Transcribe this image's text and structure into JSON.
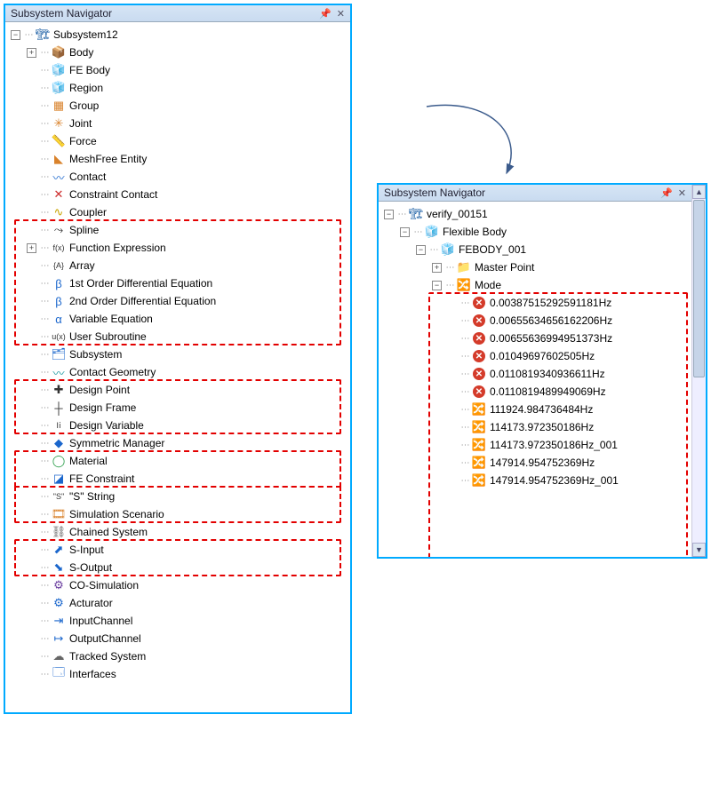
{
  "leftPanel": {
    "title": "Subsystem Navigator",
    "root": {
      "label": "Subsystem12"
    },
    "items": [
      {
        "label": "Body",
        "icon": "📦",
        "cls": "c-blue",
        "t": "+"
      },
      {
        "label": "FE Body",
        "icon": "🧊",
        "cls": "c-gold",
        "t": ""
      },
      {
        "label": "Region",
        "icon": "🧊",
        "cls": "c-gold",
        "t": ""
      },
      {
        "label": "Group",
        "icon": "▦",
        "cls": "c-orange",
        "t": ""
      },
      {
        "label": "Joint",
        "icon": "✳",
        "cls": "c-orange",
        "t": ""
      },
      {
        "label": "Force",
        "icon": "📏",
        "cls": "c-blue",
        "t": ""
      },
      {
        "label": "MeshFree Entity",
        "icon": "◣",
        "cls": "c-orange",
        "t": ""
      },
      {
        "label": "Contact",
        "icon": "〰",
        "cls": "c-blue",
        "t": ""
      },
      {
        "label": "Constraint Contact",
        "icon": "✕",
        "cls": "c-red",
        "t": ""
      },
      {
        "label": "Coupler",
        "icon": "∿",
        "cls": "c-gold",
        "t": ""
      },
      {
        "label": "Spline",
        "icon": "⤳",
        "cls": "c-dark",
        "t": ""
      },
      {
        "label": "Function Expression",
        "icon": "f(x)",
        "cls": "c-dark",
        "t": "+",
        "small": true
      },
      {
        "label": "Array",
        "icon": "{A}",
        "cls": "c-dark",
        "t": "",
        "small": true
      },
      {
        "label": "1st Order Differential Equation",
        "icon": "β",
        "cls": "c-blue",
        "t": ""
      },
      {
        "label": "2nd Order Differential Equation",
        "icon": "β",
        "cls": "c-blue",
        "t": ""
      },
      {
        "label": "Variable Equation",
        "icon": "α",
        "cls": "c-blue",
        "t": ""
      },
      {
        "label": "User Subroutine",
        "icon": "u(x)",
        "cls": "c-dark",
        "t": "",
        "small": true
      },
      {
        "label": "Subsystem",
        "icon": "🗂",
        "cls": "c-blue",
        "t": ""
      },
      {
        "label": "Contact Geometry",
        "icon": "〰",
        "cls": "c-teal",
        "t": ""
      },
      {
        "label": "Design Point",
        "icon": "✚",
        "cls": "c-dark",
        "t": ""
      },
      {
        "label": "Design Frame",
        "icon": "┼",
        "cls": "c-dark",
        "t": ""
      },
      {
        "label": "Design Variable",
        "icon": "Ⅰⅰ",
        "cls": "c-dark",
        "t": "",
        "small": true
      },
      {
        "label": "Symmetric Manager",
        "icon": "◆",
        "cls": "c-blue",
        "t": ""
      },
      {
        "label": "Material",
        "icon": "◯",
        "cls": "c-green",
        "t": ""
      },
      {
        "label": "FE Constraint",
        "icon": "◪",
        "cls": "c-blue",
        "t": ""
      },
      {
        "label": "\"S\" String",
        "icon": "\"S\"",
        "cls": "c-dark",
        "t": "",
        "small": true
      },
      {
        "label": "Simulation Scenario",
        "icon": "🎞",
        "cls": "c-orange",
        "t": ""
      },
      {
        "label": "Chained System",
        "icon": "⛓",
        "cls": "c-gray",
        "t": ""
      },
      {
        "label": "S-Input",
        "icon": "⬈",
        "cls": "c-blue",
        "t": ""
      },
      {
        "label": "S-Output",
        "icon": "⬊",
        "cls": "c-blue",
        "t": ""
      },
      {
        "label": "CO-Simulation",
        "icon": "⚙",
        "cls": "c-purple",
        "t": ""
      },
      {
        "label": "Acturator",
        "icon": "⚙",
        "cls": "c-blue",
        "t": ""
      },
      {
        "label": "InputChannel",
        "icon": "⇥",
        "cls": "c-blue",
        "t": ""
      },
      {
        "label": "OutputChannel",
        "icon": "↦",
        "cls": "c-blue",
        "t": ""
      },
      {
        "label": "Tracked System",
        "icon": "☁",
        "cls": "c-gray",
        "t": ""
      },
      {
        "label": "Interfaces",
        "icon": "🗔",
        "cls": "c-blue",
        "t": ""
      }
    ],
    "highlights": [
      {
        "from": 10,
        "to": 16
      },
      {
        "from": 19,
        "to": 21
      },
      {
        "from": 23,
        "to": 24
      },
      {
        "from": 25,
        "to": 26
      },
      {
        "from": 28,
        "to": 29
      }
    ]
  },
  "rightPanel": {
    "title": "Subsystem Navigator",
    "root": {
      "label": "verify_00151"
    },
    "child1": {
      "label": "Flexible Body"
    },
    "child2": {
      "label": "FEBODY_001"
    },
    "child3": {
      "label": "Master Point"
    },
    "child4": {
      "label": "Mode"
    },
    "modes": [
      {
        "label": "0.00387515292591181Hz",
        "err": true
      },
      {
        "label": "0.00655634656162206Hz",
        "err": true
      },
      {
        "label": "0.00655636994951373Hz",
        "err": true
      },
      {
        "label": "0.01049697602505Hz",
        "err": true
      },
      {
        "label": "0.0110819340936611Hz",
        "err": true
      },
      {
        "label": "0.0110819489949069Hz",
        "err": true
      },
      {
        "label": "111924.984736484Hz",
        "err": false
      },
      {
        "label": "114173.972350186Hz",
        "err": false
      },
      {
        "label": "114173.972350186Hz_001",
        "err": false
      },
      {
        "label": "147914.954752369Hz",
        "err": false
      },
      {
        "label": "147914.954752369Hz_001",
        "err": false
      }
    ]
  }
}
